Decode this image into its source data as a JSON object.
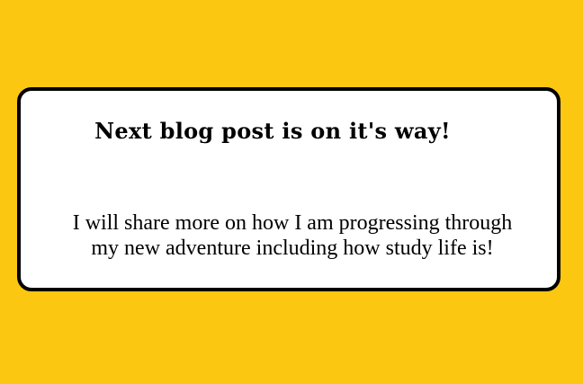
{
  "colors": {
    "background": "#FCC711",
    "card_background": "#FFFFFF",
    "card_border": "#000000",
    "text": "#000000"
  },
  "card": {
    "headline": "Next blog post is on it's way!",
    "body_line_1": "I will share more on how I am progressing through",
    "body_line_2": "my new adventure including how study life is!"
  }
}
